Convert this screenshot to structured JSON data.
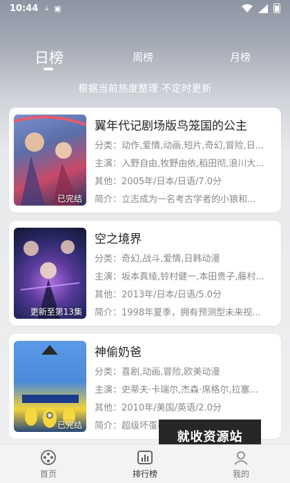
{
  "status_bar": {
    "time": "10:44"
  },
  "tabs": [
    {
      "label": "日榜",
      "active": true
    },
    {
      "label": "周榜",
      "active": false
    },
    {
      "label": "月榜",
      "active": false
    }
  ],
  "subtitle": "根据当前热度整理 不定时更新",
  "list": [
    {
      "title": "翼年代记剧场版鸟笼国的公主",
      "badge": "已完结",
      "genre_label": "分类：",
      "genre": "动作,爱情,动画,短片,奇幻,冒险,日...",
      "cast_label": "主演：",
      "cast": "入野自由,牧野由依,稻田彻,浪川大...",
      "other_label": "其他：",
      "other": "2005年/日本/日语/7.0分",
      "intro_label": "简介：",
      "intro": "立志成为一名考古学者的小狼和...",
      "poster_colors": [
        "#5a6fa8",
        "#c84a6a",
        "#2d3560"
      ]
    },
    {
      "title": "空之境界",
      "badge": "更新至第13集",
      "genre_label": "分类：",
      "genre": "奇幻,战斗,爱情,日韩动漫",
      "cast_label": "主演：",
      "cast": "坂本真绫,铃村健一,本田贵子,藤村...",
      "other_label": "其他：",
      "other": "2013年/日本/日语/5.0分",
      "intro_label": "简介：",
      "intro": "1998年夏季，拥有预测型未来视...",
      "poster_colors": [
        "#2a2a6a",
        "#8a4ab8",
        "#151530"
      ]
    },
    {
      "title": "神偷奶爸",
      "badge": "已完结",
      "genre_label": "分类：",
      "genre": "喜剧,动画,冒险,欧美动漫",
      "cast_label": "主演：",
      "cast": "史蒂夫·卡瑞尔,杰森·席格尔,拉塞...",
      "other_label": "其他：",
      "other": "2010年/美国/英语/2.0分",
      "intro_label": "简介：",
      "intro": "超级坏蛋格鲁，有着小嘛·大炸弹...",
      "poster_colors": [
        "#4a8ad8",
        "#f2d23a",
        "#2a4a7a"
      ]
    }
  ],
  "watermark": "就收资源站",
  "bottom_nav": [
    {
      "label": "首页",
      "icon": "film-reel-icon",
      "active": false
    },
    {
      "label": "排行榜",
      "icon": "chart-icon",
      "active": true
    },
    {
      "label": "我的",
      "icon": "profile-icon",
      "active": false
    }
  ]
}
